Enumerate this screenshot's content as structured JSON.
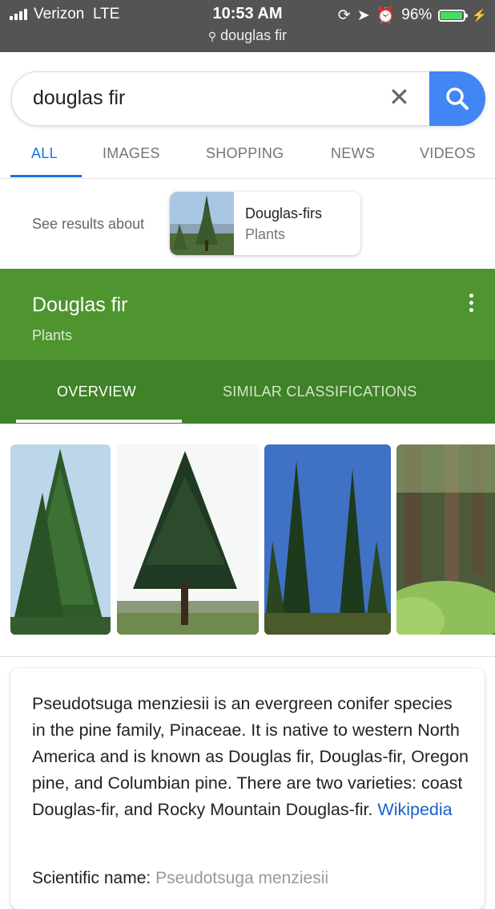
{
  "status_bar": {
    "carrier": "Verizon",
    "network": "LTE",
    "time": "10:53 AM",
    "url": "douglas fir",
    "battery": "96%",
    "battery_level": 0.96
  },
  "search": {
    "query": "douglas fir",
    "accent_color": "#4285f4"
  },
  "tabs": [
    {
      "label": "ALL",
      "active": true
    },
    {
      "label": "IMAGES"
    },
    {
      "label": "SHOPPING"
    },
    {
      "label": "NEWS"
    },
    {
      "label": "VIDEOS"
    }
  ],
  "see_results": {
    "label": "See results about",
    "card_title": "Douglas-firs",
    "card_subtitle": "Plants"
  },
  "knowledge_panel": {
    "title": "Douglas fir",
    "subtitle": "Plants",
    "color": "#4e9530",
    "tabs": [
      {
        "label": "OVERVIEW",
        "active": true
      },
      {
        "label": "SIMILAR CLASSIFICATIONS"
      }
    ],
    "description": "Pseudotsuga menziesii is an evergreen conifer species in the pine family, Pinaceae. It is native to western North America and is known as Douglas fir, Douglas-fir, Oregon pine, and Columbian pine. There are two varieties: coast Douglas-fir, and Rocky Mountain Douglas-fir.",
    "source_link": "Wikipedia",
    "scientific_name_label": "Scientific name:",
    "scientific_name_value": "Pseudotsuga menziesii"
  }
}
